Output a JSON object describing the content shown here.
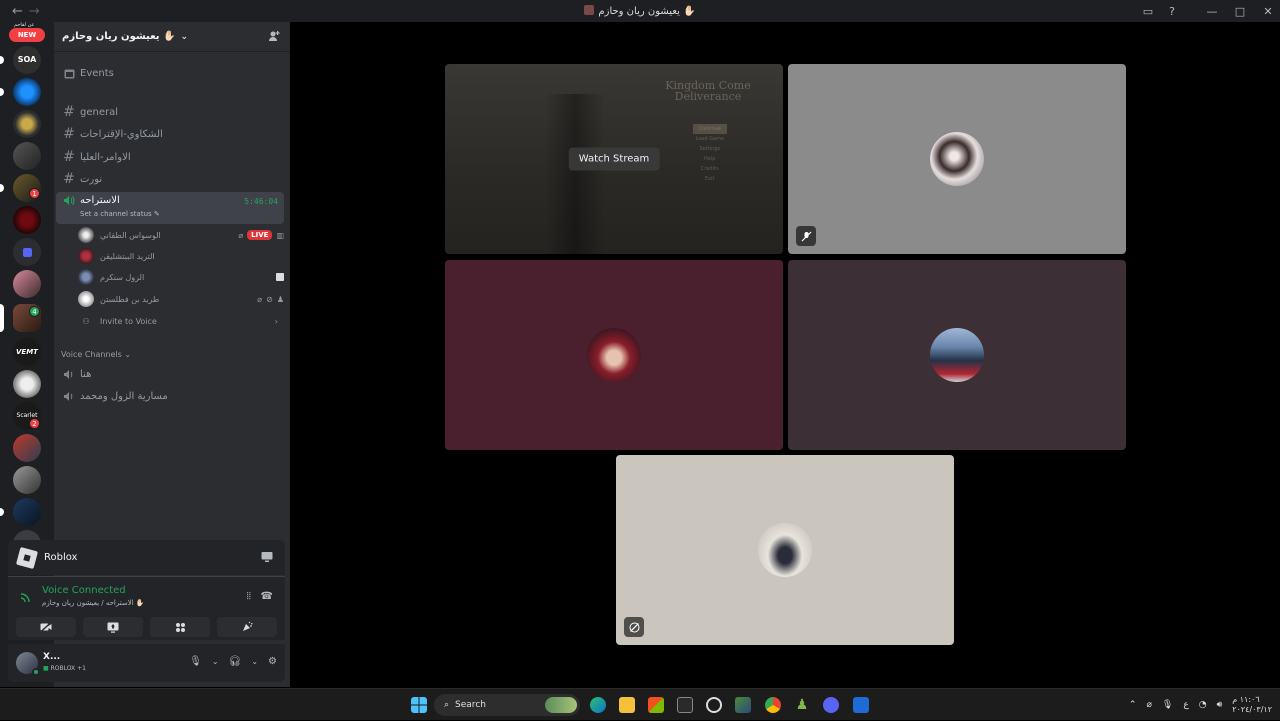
{
  "window": {
    "title": "يعيشون ريان وحازم ✋🏻",
    "back_label": "←",
    "forward_label": "→"
  },
  "server_rail": {
    "new_badge": "NEW",
    "new_top_text": "عن لقاحم",
    "badges": [
      "1",
      "4",
      "2"
    ],
    "labels": [
      "SOA",
      "VEMT",
      "Scarlet"
    ]
  },
  "guild": {
    "name": "يعيشون ريان وحازم ✋🏻",
    "events_label": "Events",
    "text_channels": [
      {
        "name": "general"
      },
      {
        "name": "الشكاوي-الإقتراحات"
      },
      {
        "name": "الاوامر-العليا"
      },
      {
        "name": "نورت"
      }
    ],
    "active_voice": {
      "name": "الاستراحه",
      "timer": "5:46:04",
      "status_prompt": "Set a channel status ✎"
    },
    "voice_users": [
      {
        "name": "الوسواس الطقاني",
        "live": "LIVE"
      },
      {
        "name": "التريد الببتشليقن"
      },
      {
        "name": "الزول سنكرم"
      },
      {
        "name": "طريد بن فطلستن"
      }
    ],
    "invite_label": "Invite to Voice",
    "category_label": "Voice Channels",
    "voice_channels": [
      {
        "name": "هنا"
      },
      {
        "name": "مسارية الزول ومحمد"
      }
    ]
  },
  "activity": {
    "name": "Roblox"
  },
  "voice_connection": {
    "status": "Voice Connected",
    "location": "الاستراحه / يعيشون ريان وحازم ✋🏻"
  },
  "user": {
    "name": "X...",
    "activity": "ROBLOX +1"
  },
  "stage": {
    "watch_label": "Watch Stream",
    "stream_game_title": "Kingdom Come Deliverance",
    "stream_menu": [
      "Continue",
      "Load Game",
      "Settings",
      "Help",
      "Credits",
      "Exit"
    ],
    "tiles": [
      {
        "color": "#2b2b2b"
      },
      {
        "color": "#8b8b8b"
      },
      {
        "color": "#4a1f2e"
      },
      {
        "color": "#3c2f36"
      },
      {
        "color": "#cbc6bd"
      }
    ]
  },
  "taskbar": {
    "search_label": "Search",
    "lang": "ع",
    "time": "١١:٠٦ م",
    "date": "٢٠٢٤/٠٣/١٢"
  }
}
